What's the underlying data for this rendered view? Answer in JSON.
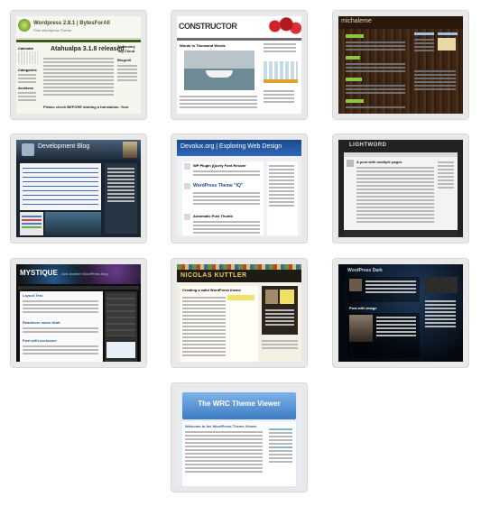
{
  "themes": [
    {
      "name": "thumb-wordpress-bytesforall",
      "title": "Wordpress 2.8.1 | BytesForAll",
      "subtitle": "Free Wordpress Theme",
      "headline": "Atahualpa 3.1.8 released",
      "widgets": [
        "Calendar",
        "Categories",
        "Archives"
      ],
      "right_title": "Taxonomy Tag Cloud",
      "right_sub": "Blogroll",
      "notice": "Please check BEFORE starting a translation. Your"
    },
    {
      "name": "thumb-constructor",
      "title": "CONSTRUCTOR",
      "post_title": "Words in Thousand Words"
    },
    {
      "name": "thumb-michaleme",
      "title": "michaleme"
    },
    {
      "name": "thumb-development-blog",
      "title": "Development Blog"
    },
    {
      "name": "thumb-devolux",
      "title": "Devolux.org | Exploring Web Design",
      "posts": [
        "WP Plugin jQuery Font Resizer",
        "WordPress Theme \"IQ\"",
        "Automatic Post Thumb"
      ]
    },
    {
      "name": "thumb-lightword",
      "title": "LIGHTWORD",
      "post_title": "A post with multiple pages"
    },
    {
      "name": "thumb-mystique",
      "title": "MYSTIQUE",
      "tagline": "Just another WordPress blog",
      "posts": [
        "Layout Test",
        "Readmore name dealt",
        "Post with enclosure"
      ]
    },
    {
      "name": "thumb-nicolas-kuttler",
      "title": "NICOLAS KUTTLER",
      "post_title": "Creating a valid WordPress theme"
    },
    {
      "name": "thumb-wordpress-dark",
      "title": "WordPress Dark",
      "post_title": "Post with image"
    },
    {
      "name": "thumb-wrc-theme-viewer",
      "title": "The WRC Theme Viewer",
      "post_title": "Welcome to the WordPress Theme Viewer"
    }
  ]
}
